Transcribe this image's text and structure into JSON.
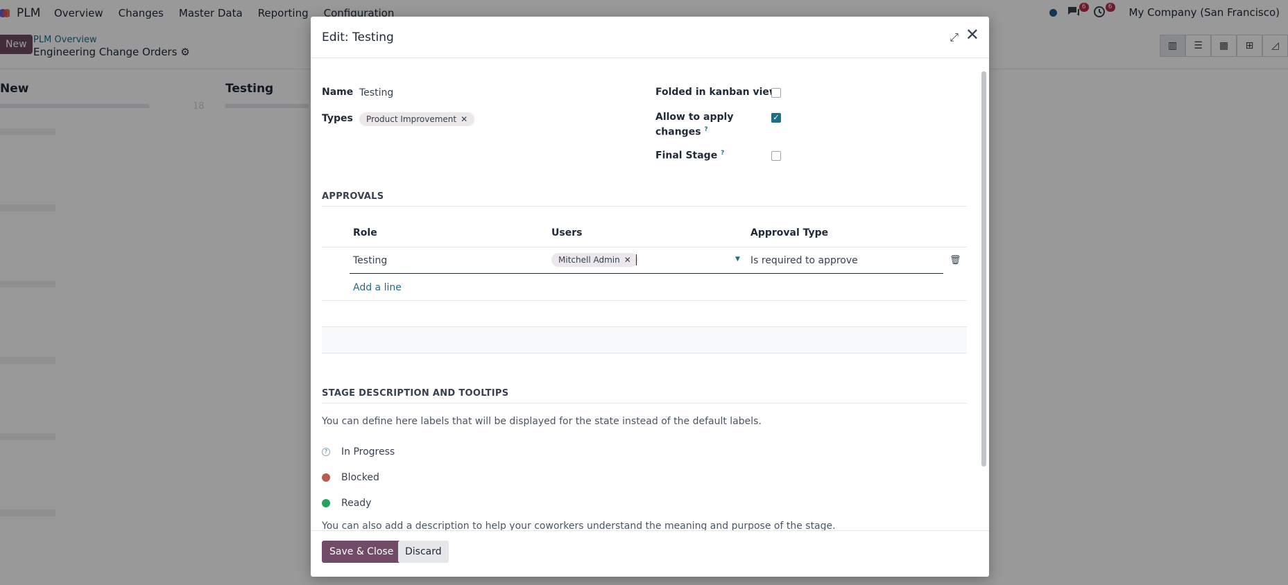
{
  "topbar": {
    "app_name": "PLM",
    "menu": [
      "Overview",
      "Changes",
      "Master Data",
      "Reporting",
      "Configuration"
    ],
    "messages_count": "6",
    "activities_count": "6",
    "company": "My Company (San Francisco)"
  },
  "control": {
    "new_label": "New",
    "breadcrumb_parent": "PLM Overview",
    "breadcrumb_current": "Engineering Change Orders",
    "views": [
      "kanban-icon",
      "list-icon",
      "calendar-icon",
      "pivot-icon",
      "graph-icon"
    ]
  },
  "kanban": {
    "columns": [
      {
        "title": "New",
        "count": "18"
      },
      {
        "title": "Testing"
      }
    ]
  },
  "dialog": {
    "title": "Edit: Testing",
    "name_label": "Name",
    "name_value": "Testing",
    "types_label": "Types",
    "types_tags": [
      "Product Improvement"
    ],
    "folded_label": "Folded in kanban view",
    "folded_checked": false,
    "allow_label_1": "Allow to apply",
    "allow_label_2": "changes",
    "allow_checked": true,
    "final_label": "Final Stage",
    "final_checked": false,
    "approvals_title": "APPROVALS",
    "approvals_headers": {
      "role": "Role",
      "users": "Users",
      "approval_type": "Approval Type"
    },
    "approvals_rows": [
      {
        "role": "Testing",
        "user_tag": "Mitchell Admin",
        "approval_type": "Is required to approve"
      }
    ],
    "add_line": "Add a line",
    "stage_desc_title": "STAGE DESCRIPTION AND TOOLTIPS",
    "stage_desc_intro": "You can define here labels that will be displayed for the state instead of the default labels.",
    "states": [
      {
        "label": "In Progress",
        "color": "#ffffff"
      },
      {
        "label": "Blocked",
        "color": "#b85c4f"
      },
      {
        "label": "Ready",
        "color": "#22a55a"
      }
    ],
    "stage_desc_outro": "You can also add a description to help your coworkers understand the meaning and purpose of the stage.",
    "save_label": "Save & Close",
    "discard_label": "Discard"
  },
  "colors": {
    "brand": "#714b67",
    "link": "#1f6e87",
    "badge": "#b22d45"
  }
}
